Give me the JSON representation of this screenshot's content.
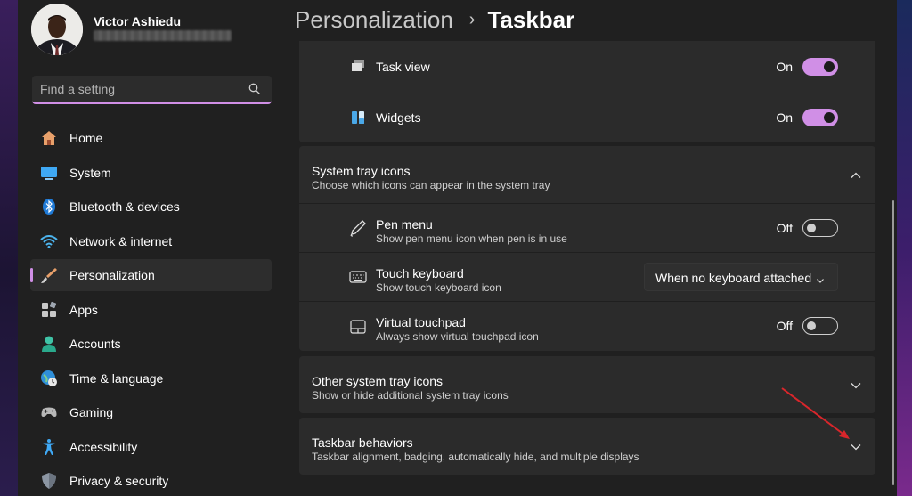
{
  "user": {
    "name": "Victor Ashiedu"
  },
  "search": {
    "placeholder": "Find a setting",
    "icon": "search-icon"
  },
  "sidebar": {
    "items": [
      {
        "label": "Home",
        "icon": "home-icon",
        "active": false
      },
      {
        "label": "System",
        "icon": "system-icon",
        "active": false
      },
      {
        "label": "Bluetooth & devices",
        "icon": "bluetooth-icon",
        "active": false
      },
      {
        "label": "Network & internet",
        "icon": "wifi-icon",
        "active": false
      },
      {
        "label": "Personalization",
        "icon": "brush-icon",
        "active": true
      },
      {
        "label": "Apps",
        "icon": "apps-icon",
        "active": false
      },
      {
        "label": "Accounts",
        "icon": "person-icon",
        "active": false
      },
      {
        "label": "Time & language",
        "icon": "globe-clock-icon",
        "active": false
      },
      {
        "label": "Gaming",
        "icon": "gamepad-icon",
        "active": false
      },
      {
        "label": "Accessibility",
        "icon": "accessibility-icon",
        "active": false
      },
      {
        "label": "Privacy & security",
        "icon": "shield-icon",
        "active": false
      }
    ]
  },
  "breadcrumb": {
    "parent": "Personalization",
    "separator": "›",
    "current": "Taskbar"
  },
  "taskbar_items": [
    {
      "title": "Task view",
      "state": "On",
      "on": true,
      "icon": "task-view-icon"
    },
    {
      "title": "Widgets",
      "state": "On",
      "on": true,
      "icon": "widgets-icon"
    }
  ],
  "system_tray": {
    "title": "System tray icons",
    "subtitle": "Choose which icons can appear in the system tray",
    "expanded": true,
    "items": [
      {
        "title": "Pen menu",
        "subtitle": "Show pen menu icon when pen is in use",
        "state": "Off",
        "on": false,
        "icon": "pen-icon"
      },
      {
        "title": "Touch keyboard",
        "subtitle": "Show touch keyboard icon",
        "dropdown_value": "When no keyboard attached",
        "icon": "keyboard-icon"
      },
      {
        "title": "Virtual touchpad",
        "subtitle": "Always show virtual touchpad icon",
        "state": "Off",
        "on": false,
        "icon": "touchpad-icon"
      }
    ]
  },
  "other_tray": {
    "title": "Other system tray icons",
    "subtitle": "Show or hide additional system tray icons"
  },
  "behaviors": {
    "title": "Taskbar behaviors",
    "subtitle": "Taskbar alignment, badging, automatically hide, and multiple displays"
  },
  "colors": {
    "accent": "#d08fe6",
    "card": "#2b2b2b",
    "background": "#202020",
    "annotation_arrow": "#d9262b"
  }
}
